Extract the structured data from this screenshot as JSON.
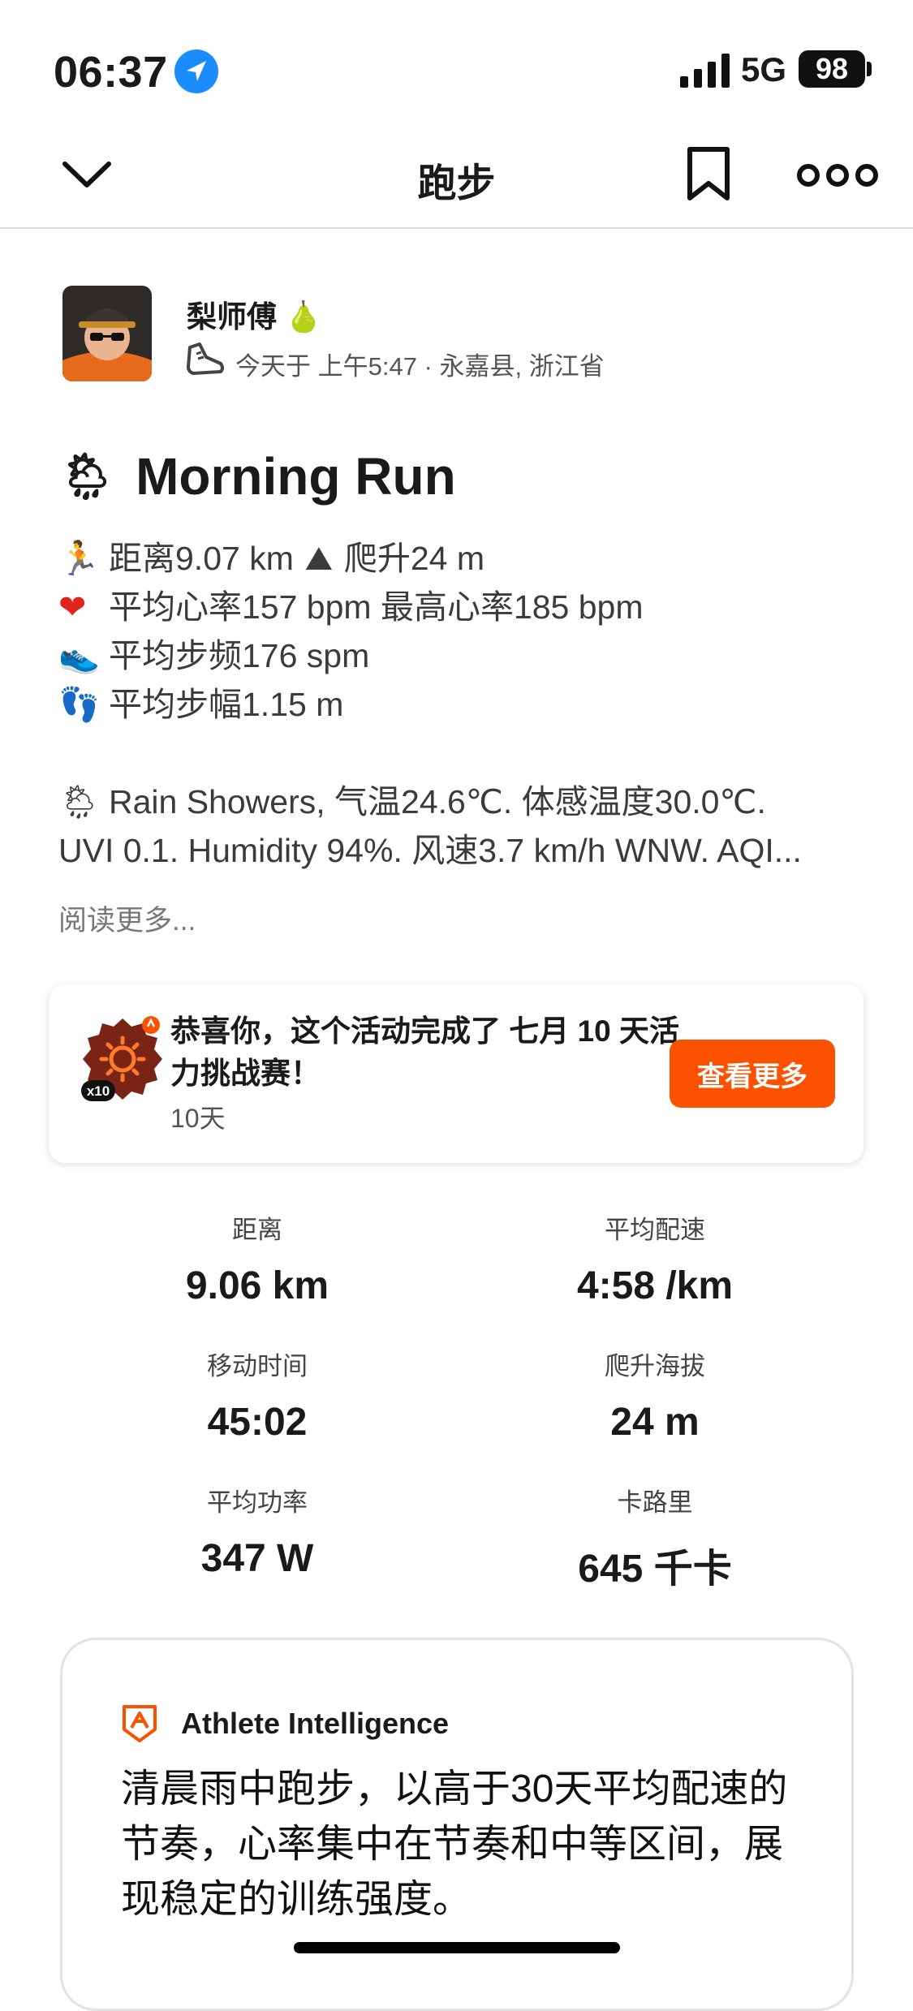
{
  "status_bar": {
    "time": "06:37",
    "network": "5G",
    "battery": "98"
  },
  "nav": {
    "title": "跑步"
  },
  "athlete": {
    "name": "梨师傅",
    "name_emoji": "🍐",
    "meta": "今天于 上午5:47 · 永嘉县, 浙江省"
  },
  "activity": {
    "title_emoji": "🌦",
    "title": "Morning Run",
    "lines": [
      {
        "emoji": "🏃",
        "text": "距离9.07 km",
        "emoji2": "⛰",
        "text2": "爬升24 m"
      },
      {
        "emoji": "❤",
        "text": "平均心率157 bpm 最高心率185 bpm"
      },
      {
        "emoji": "👟",
        "text": "平均步频176 spm"
      },
      {
        "emoji": "👣",
        "text": "平均步幅1.15 m"
      }
    ],
    "weather_emoji": "🌦",
    "weather_line1": "Rain Showers, 气温24.6℃. 体感温度30.0℃.",
    "weather_line2": "UVI 0.1. Humidity 94%. 风速3.7 km/h WNW. AQI...",
    "read_more": "阅读更多..."
  },
  "challenge": {
    "badge_count": "x10",
    "title": "恭喜你，这个活动完成了 七月 10 天活力挑战赛！",
    "subtitle": "10天",
    "button": "查看更多"
  },
  "stats": [
    {
      "label": "距离",
      "value": "9.06 km"
    },
    {
      "label": "平均配速",
      "value": "4:58 /km"
    },
    {
      "label": "移动时间",
      "value": "45:02"
    },
    {
      "label": "爬升海拔",
      "value": "24 m"
    },
    {
      "label": "平均功率",
      "value": "347 W"
    },
    {
      "label": "卡路里",
      "value": "645 千卡"
    }
  ],
  "athlete_intelligence": {
    "label": "Athlete Intelligence",
    "text": "清晨雨中跑步，以高于30天平均配速的节奏，心率集中在节奏和中等区间，展现稳定的训练强度。"
  },
  "colors": {
    "accent": "#fc5200",
    "location": "#1a8cff"
  },
  "icons": [
    "location-arrow-icon",
    "signal-icon",
    "chevron-down-icon",
    "bookmark-icon",
    "more-icon",
    "shoe-icon",
    "athlete-intelligence-icon"
  ]
}
